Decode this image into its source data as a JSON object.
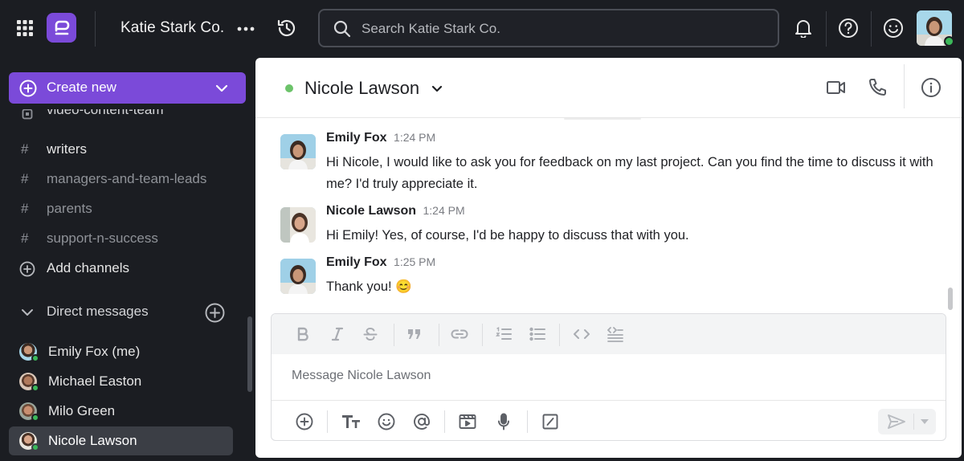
{
  "topbar": {
    "workspace_name": "Katie Stark Co.",
    "search_placeholder": "Search Katie Stark Co."
  },
  "sidebar": {
    "create_label": "Create new",
    "channels": [
      {
        "name": "video-content-team",
        "dim": false
      },
      {
        "name": "writers",
        "dim": false
      },
      {
        "name": "managers-and-team-leads",
        "dim": true
      },
      {
        "name": "parents",
        "dim": true
      },
      {
        "name": "support-n-success",
        "dim": true
      }
    ],
    "add_channels": "Add channels",
    "dm_header": "Direct messages",
    "dms": [
      {
        "name": "Emily Fox (me)",
        "status": "online"
      },
      {
        "name": "Michael Easton",
        "status": "online"
      },
      {
        "name": "Milo Green",
        "status": "online"
      },
      {
        "name": "Nicole Lawson",
        "status": "online",
        "selected": true
      }
    ]
  },
  "channel": {
    "title": "Nicole Lawson",
    "status_color": "#6cc36a"
  },
  "messages": [
    {
      "author": "Emily Fox",
      "time": "1:24 PM",
      "text": "Hi Nicole, I would like to ask you for feedback on my last project. Can you find the time to discuss it with me? I'd truly appreciate it."
    },
    {
      "author": "Nicole Lawson",
      "time": "1:24 PM",
      "text": "Hi Emily! Yes, of course, I'd be happy to discuss that with you."
    },
    {
      "author": "Emily Fox",
      "time": "1:25 PM",
      "text": "Thank you! 😊"
    }
  ],
  "composer": {
    "placeholder": "Message Nicole Lawson"
  },
  "colors": {
    "accent": "#7b4ad9",
    "online": "#3cb85a"
  }
}
